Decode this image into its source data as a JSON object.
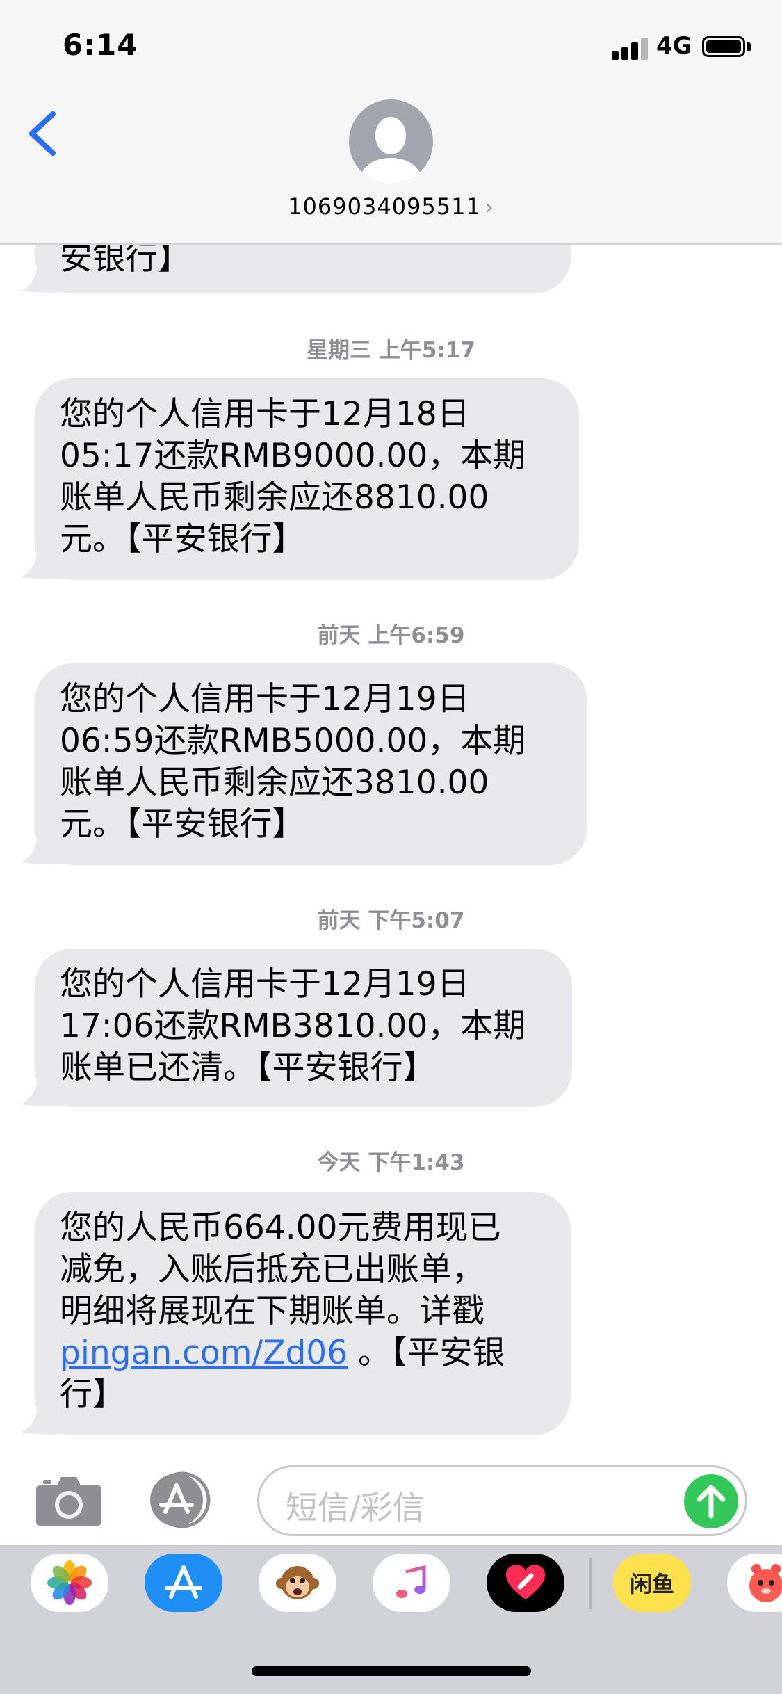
{
  "status_bar": {
    "time": "6:14",
    "network": "4G"
  },
  "header": {
    "contact": "1069034095511"
  },
  "messages": [
    {
      "id": "m0",
      "text": "安银行】"
    },
    {
      "id": "m1",
      "timestamp_day": "星期三",
      "timestamp_time": "上午5:17",
      "lines": [
        "您的个人信用卡于12月18日",
        "05:17还款RMB9000.00，本期",
        "账单人民币剩余应还8810.00",
        "元。【平安银行】"
      ]
    },
    {
      "id": "m2",
      "timestamp_day": "前天",
      "timestamp_time": "上午6:59",
      "lines": [
        "您的个人信用卡于12月19日",
        "06:59还款RMB5000.00，本期",
        "账单人民币剩余应还3810.00",
        "元。【平安银行】"
      ]
    },
    {
      "id": "m3",
      "timestamp_day": "前天",
      "timestamp_time": "下午5:07",
      "lines": [
        "您的个人信用卡于12月19日",
        "17:06还款RMB3810.00，本期",
        "账单已还清。【平安银行】"
      ]
    },
    {
      "id": "m4",
      "timestamp_day": "今天",
      "timestamp_time": "下午1:43",
      "lines": [
        "您的人民币664.00元费用现已",
        "减免，入账后抵充已出账单，",
        "明细将展现在下期账单。详戳"
      ],
      "link": "pingan.com/Zd06",
      "after_link": " 。【平安银",
      "last_line": "行】"
    }
  ],
  "input": {
    "placeholder": "短信/彩信"
  },
  "app_drawer": {
    "icons": [
      "photos-icon",
      "app-store-icon",
      "animoji-icon",
      "music-icon",
      "digital-touch-icon",
      "xianyu-icon",
      "sticker-icon"
    ],
    "xianyu_label": "闲鱼"
  },
  "colors": {
    "accent": "#2b6ef0",
    "bubble": "#e9e9eb",
    "send": "#34c759",
    "header_bg": "#f6f6f7"
  }
}
